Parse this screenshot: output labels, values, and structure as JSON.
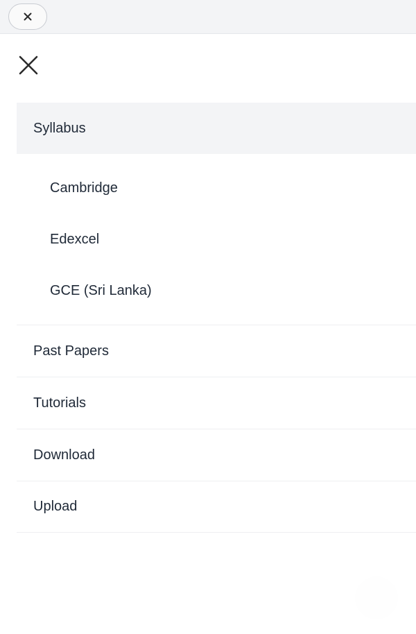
{
  "topbar": {
    "close_icon": "close-icon"
  },
  "menu": {
    "close_icon": "close-x-icon",
    "active_item": "Syllabus",
    "submenu": [
      "Cambridge",
      "Edexcel",
      "GCE (Sri Lanka)"
    ],
    "items": [
      "Past Papers",
      "Tutorials",
      "Download",
      "Upload"
    ]
  },
  "colors": {
    "text": "#1f2937",
    "active_bg": "#f3f4f6",
    "divider": "#eeeff1"
  }
}
